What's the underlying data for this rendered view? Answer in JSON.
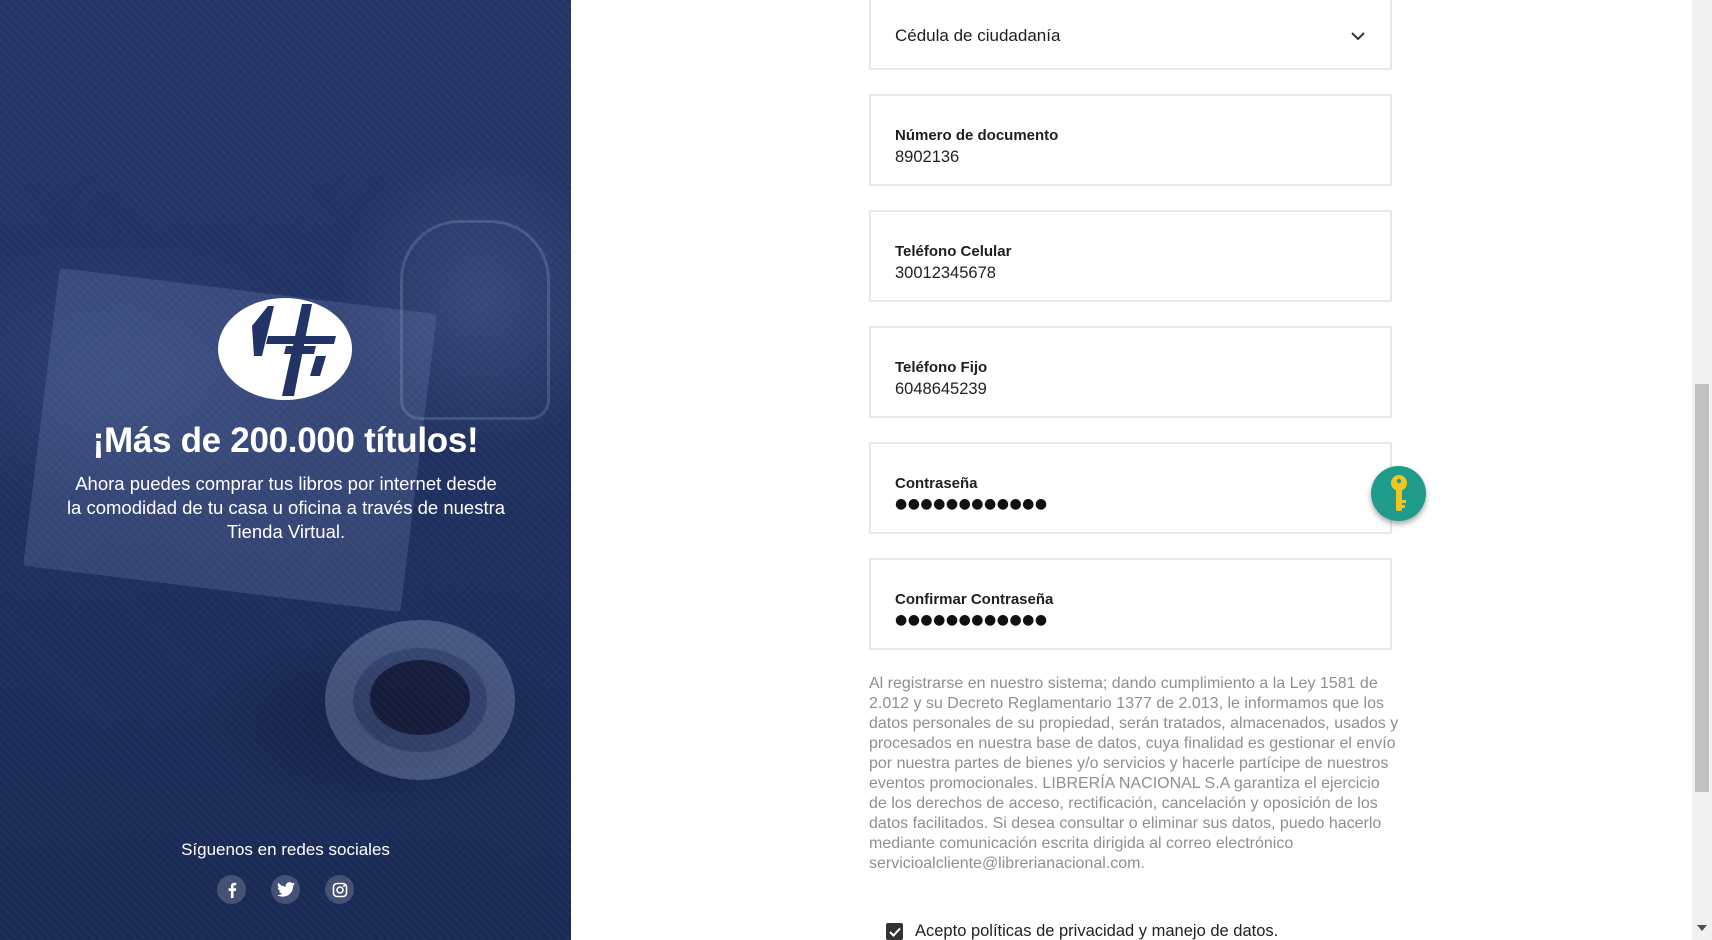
{
  "left_panel": {
    "headline": "¡Más de 200.000 títulos!",
    "subtext": "Ahora puedes comprar tus libros por internet desde la comodidad de tu casa u oficina a través de nuestra Tienda Virtual.",
    "social_title": "Síguenos en redes sociales",
    "social_icons": [
      "facebook-icon",
      "twitter-icon",
      "instagram-icon"
    ]
  },
  "form": {
    "document_type": {
      "value": "Cédula de ciudadanía"
    },
    "document_number": {
      "label": "Número de documento",
      "value": "8902136"
    },
    "mobile_phone": {
      "label": "Teléfono Celular",
      "value": "30012345678"
    },
    "landline_phone": {
      "label": "Teléfono Fijo",
      "value": "6048645239"
    },
    "password": {
      "label": "Contraseña",
      "value": "●●●●●●●●●●●●"
    },
    "confirm_password": {
      "label": "Confirmar Contraseña",
      "value": "●●●●●●●●●●●●"
    },
    "legal_text": "Al registrarse en nuestro sistema; dando cumplimiento a la Ley 1581 de 2.012 y su Decreto Reglamentario 1377 de 2.013, le informamos que los datos personales de su propiedad, serán tratados, almacenados, usados y procesados en nuestra base de datos, cuya finalidad es gestionar el envío por nuestra partes de bienes y/o servicios y hacerle partícipe de nuestros eventos promocionales. LIBRERÍA NACIONAL S.A garantiza el ejercicio de los derechos de acceso, rectificación, cancelación y oposición de los datos facilitados. Si desea consultar o eliminar sus datos, puedo hacerlo mediante comunicación escrita dirigida al correo electrónico servicioalcliente@librerianacional.com.",
    "consent_label": "Acepto políticas de privacidad y manejo de datos."
  },
  "colors": {
    "panel_bg": "#223465",
    "key_button": "#1f9b8b"
  }
}
